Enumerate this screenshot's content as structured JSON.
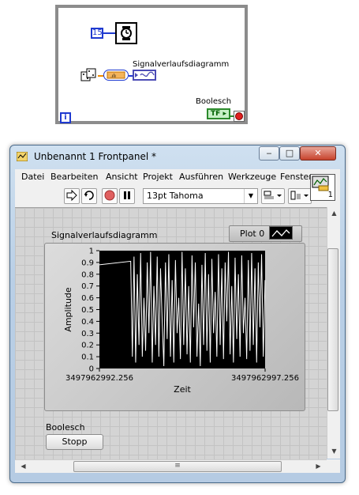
{
  "block_diagram": {
    "constant_value": "15",
    "waveform_label": "Signalverlaufsdiagramm",
    "boolean_label": "Boolesch",
    "boolean_terminal_text": "TF",
    "iteration_label": "i"
  },
  "window": {
    "title": "Unbenannt 1 Frontpanel *",
    "minimize": "‒",
    "maximize": "□",
    "close": "✕"
  },
  "menu": [
    {
      "label": "Datei"
    },
    {
      "label": "Bearbeiten"
    },
    {
      "label": "Ansicht"
    },
    {
      "label": "Projekt"
    },
    {
      "label": "Ausführen"
    },
    {
      "label": "Werkzeuge"
    },
    {
      "label": "Fenster"
    }
  ],
  "toolbar": {
    "run_icon": "run-arrow-icon",
    "continuous_run_icon": "continuous-run-icon",
    "abort_icon": "abort-icon",
    "pause_icon": "pause-icon",
    "font_value": "13pt Tahoma",
    "vi_connector_number": "1"
  },
  "front_panel": {
    "chart_title": "Signalverlaufsdiagramm",
    "legend_plot": "Plot 0",
    "boolean_label": "Boolesch",
    "stop_button": "Stopp"
  },
  "chart_data": {
    "type": "line",
    "title": "Signalverlaufsdiagramm",
    "xlabel": "Zeit",
    "ylabel": "Amplitude",
    "x_tick_labels": [
      "3497962992.256",
      "3497962997.256"
    ],
    "xlim": [
      3497962992.256,
      3497962997.256
    ],
    "ylim": [
      0,
      1
    ],
    "y_ticks": [
      0,
      0.1,
      0.2,
      0.3,
      0.4,
      0.5,
      0.6,
      0.7,
      0.8,
      0.9,
      1
    ],
    "background": "#000000",
    "line_color": "#ffffff",
    "grid": false,
    "series": [
      {
        "name": "Plot 0",
        "x": [
          3497962992.256,
          3497962993.2,
          3497962993.25,
          3497962993.3,
          3497962993.35,
          3497962993.4,
          3497962993.45,
          3497962993.5,
          3497962993.55,
          3497962993.6,
          3497962993.65,
          3497962993.7,
          3497962993.75,
          3497962993.8,
          3497962993.85,
          3497962993.9,
          3497962993.95,
          3497962994.0,
          3497962994.05,
          3497962994.1,
          3497962994.15,
          3497962994.2,
          3497962994.25,
          3497962994.3,
          3497962994.35,
          3497962994.4,
          3497962994.45,
          3497962994.5,
          3497962994.55,
          3497962994.6,
          3497962994.65,
          3497962994.7,
          3497962994.75,
          3497962994.8,
          3497962994.85,
          3497962994.9,
          3497962994.95,
          3497962995.0,
          3497962995.05,
          3497962995.1,
          3497962995.15,
          3497962995.2,
          3497962995.25,
          3497962995.3,
          3497962995.35,
          3497962995.4,
          3497962995.45,
          3497962995.5,
          3497962995.55,
          3497962995.6,
          3497962995.65,
          3497962995.7,
          3497962995.75,
          3497962995.8,
          3497962995.85,
          3497962995.9,
          3497962995.95,
          3497962996.0,
          3497962996.05,
          3497962996.1,
          3497962996.15,
          3497962996.2,
          3497962996.25,
          3497962996.3,
          3497962996.35,
          3497962996.4,
          3497962996.45,
          3497962996.5,
          3497962996.55,
          3497962996.6,
          3497962996.65,
          3497962996.7,
          3497962996.75,
          3497962996.8,
          3497962996.85,
          3497962996.9,
          3497962996.95,
          3497962997.0,
          3497962997.05,
          3497962997.1,
          3497962997.15,
          3497962997.2,
          3497962997.256
        ],
        "y": [
          0.88,
          0.91,
          0.1,
          0.95,
          0.05,
          0.8,
          0.2,
          0.98,
          0.1,
          0.6,
          0.15,
          0.9,
          0.3,
          0.99,
          0.05,
          0.7,
          0.2,
          0.95,
          0.1,
          0.85,
          0.4,
          0.02,
          0.9,
          0.25,
          0.97,
          0.1,
          0.75,
          0.05,
          0.92,
          0.3,
          0.6,
          0.08,
          0.99,
          0.2,
          0.85,
          0.12,
          0.7,
          0.05,
          0.96,
          0.35,
          0.9,
          0.1,
          0.55,
          0.02,
          0.88,
          0.2,
          0.98,
          0.15,
          0.8,
          0.05,
          0.93,
          0.3,
          0.65,
          0.1,
          0.97,
          0.2,
          0.85,
          0.08,
          0.9,
          0.4,
          0.99,
          0.12,
          0.7,
          0.05,
          0.94,
          0.25,
          0.8,
          0.1,
          0.96,
          0.3,
          0.6,
          0.08,
          0.92,
          0.15,
          0.98,
          0.2,
          0.85,
          0.05,
          0.9,
          0.35,
          0.97,
          0.1,
          0.75
        ]
      }
    ]
  }
}
